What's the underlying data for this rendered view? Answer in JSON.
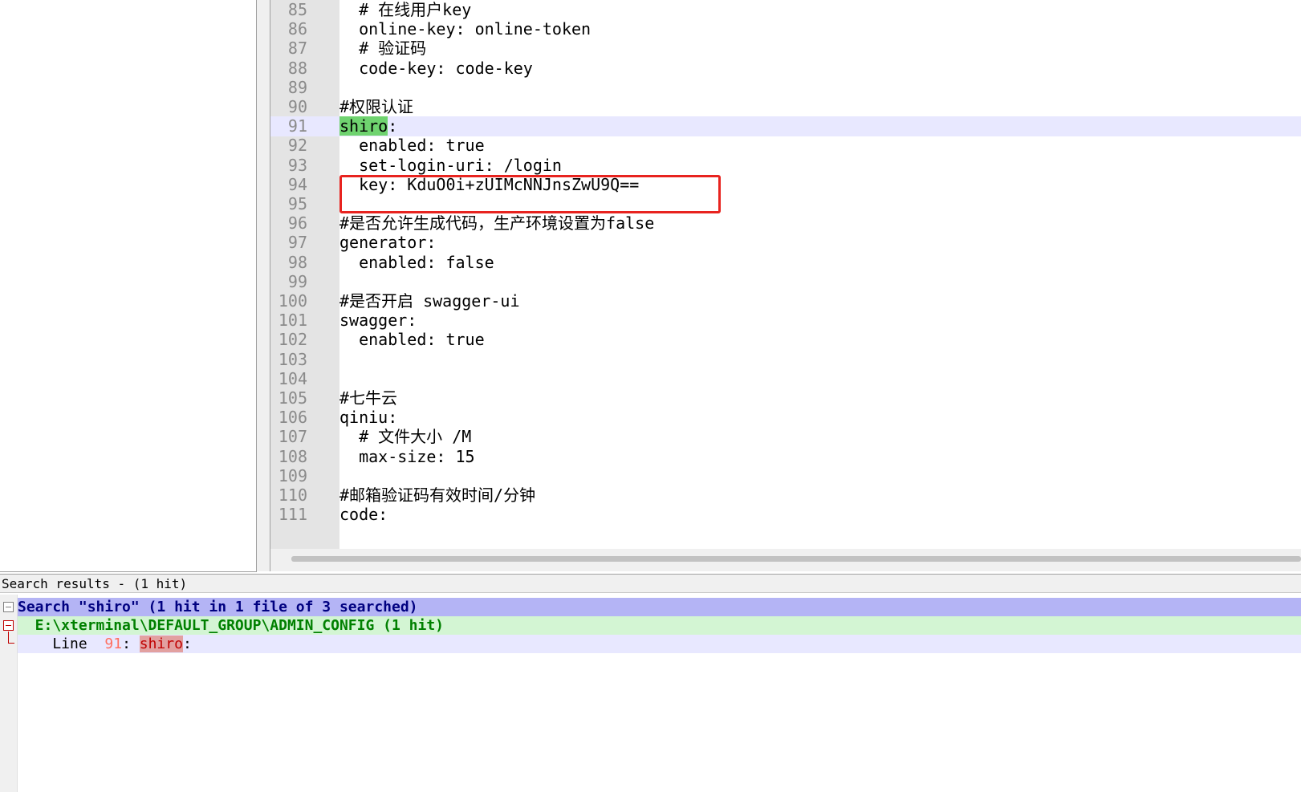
{
  "editor": {
    "current_line": "91",
    "lines": [
      {
        "num": "85",
        "text": "  # 在线用户key"
      },
      {
        "num": "86",
        "text": "  online-key: online-token"
      },
      {
        "num": "87",
        "text": "  # 验证码"
      },
      {
        "num": "88",
        "text": "  code-key: code-key"
      },
      {
        "num": "89",
        "text": ""
      },
      {
        "num": "90",
        "text": "#权限认证"
      },
      {
        "num": "91",
        "highlight": "shiro",
        "text": ":"
      },
      {
        "num": "92",
        "text": "  enabled: true"
      },
      {
        "num": "93",
        "text": "  set-login-uri: /login"
      },
      {
        "num": "94",
        "text": "  key: KduO0i+zUIMcNNJnsZwU9Q=="
      },
      {
        "num": "95",
        "text": ""
      },
      {
        "num": "96",
        "text": "#是否允许生成代码，生产环境设置为false"
      },
      {
        "num": "97",
        "text": "generator:"
      },
      {
        "num": "98",
        "text": "  enabled: false"
      },
      {
        "num": "99",
        "text": ""
      },
      {
        "num": "100",
        "text": "#是否开启 swagger-ui"
      },
      {
        "num": "101",
        "text": "swagger:"
      },
      {
        "num": "102",
        "text": "  enabled: true"
      },
      {
        "num": "103",
        "text": ""
      },
      {
        "num": "104",
        "text": ""
      },
      {
        "num": "105",
        "text": "#七牛云"
      },
      {
        "num": "106",
        "text": "qiniu:"
      },
      {
        "num": "107",
        "text": "  # 文件大小 /M"
      },
      {
        "num": "108",
        "text": "  max-size: 15"
      },
      {
        "num": "109",
        "text": ""
      },
      {
        "num": "110",
        "text": "#邮箱验证码有效时间/分钟"
      },
      {
        "num": "111",
        "text": "code:"
      }
    ]
  },
  "search": {
    "panel_title": "Search results - (1 hit)",
    "header": "Search \"shiro\" (1 hit in 1 file of 3 searched)",
    "file": "  E:\\xterminal\\DEFAULT_GROUP\\ADMIN_CONFIG (1 hit)",
    "result": {
      "prefix": "    Line  ",
      "line_num": "91",
      "sep": ": ",
      "hit": "shiro",
      "suffix": ":"
    }
  },
  "colors": {
    "annotation_box": "#e8231f",
    "match_highlight": "#6fd36f",
    "search_header_bg": "#b4b4f5",
    "search_file_bg": "#d3f5d3"
  }
}
